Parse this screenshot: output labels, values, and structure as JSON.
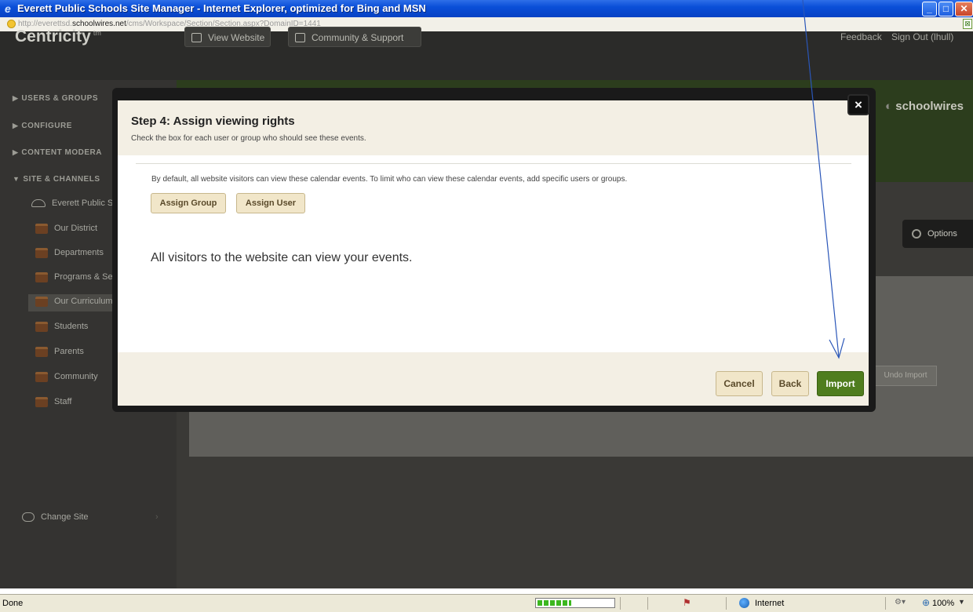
{
  "window": {
    "title": "Everett Public Schools Site Manager - Internet Explorer, optimized for Bing and MSN",
    "url_host": "http://everettsd.",
    "url_domain": "schoolwires.net",
    "url_path": "/cms/Workspace/Section/Section.aspx?DomainID=1441"
  },
  "app": {
    "logo": "Centricity",
    "logo_tm": "tm",
    "nav": {
      "view_website": "View Website",
      "community_support": "Community & Support",
      "feedback": "Feedback",
      "sign_out": "Sign Out (lhull)"
    }
  },
  "sidebar": {
    "headers": [
      "USERS & GROUPS",
      "CONFIGURE",
      "CONTENT MODERA",
      "SITE & CHANNELS"
    ],
    "site_name": "Everett Public S",
    "items": [
      "Our District",
      "Departments",
      "Programs & Se",
      "Our Curriculum",
      "Students",
      "Parents",
      "Community",
      "Staff"
    ],
    "change_site": "Change Site"
  },
  "main": {
    "brand": "schoolwires",
    "options": "Options",
    "undo_import": "Undo Import"
  },
  "modal": {
    "title": "Step 4: Assign viewing rights",
    "subtitle": "Check the box for each user or group who should see these events.",
    "info": "By default, all website visitors can view these calendar events. To limit who can view these calendar events, add specific users or groups.",
    "assign_group": "Assign Group",
    "assign_user": "Assign User",
    "visitors_text": "All visitors to the website can view your events.",
    "cancel": "Cancel",
    "back": "Back",
    "import": "Import",
    "close": "×"
  },
  "statusbar": {
    "status": "Done",
    "zone": "Internet",
    "zoom": "100%",
    "progress_fraction": 0.45
  },
  "colors": {
    "import_green": "#4f7d1e",
    "annotation_arrow": "#2a56b8"
  }
}
